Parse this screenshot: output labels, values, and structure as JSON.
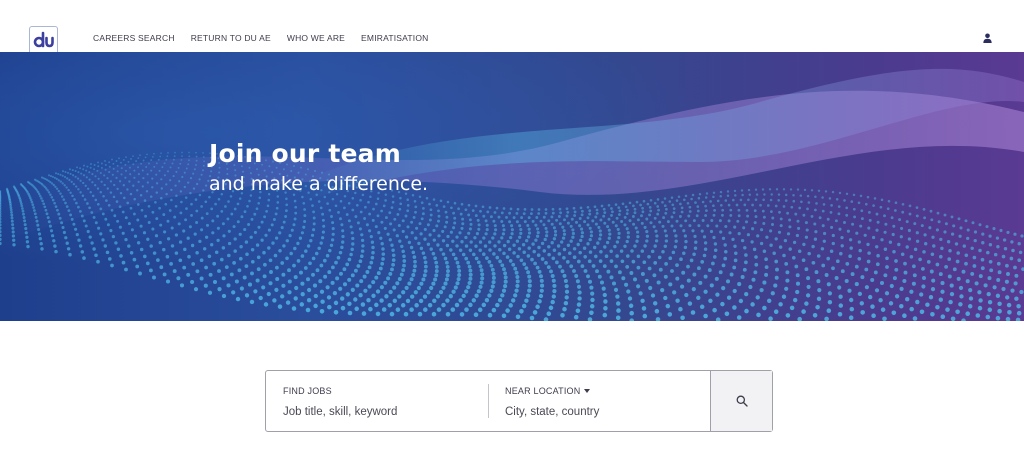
{
  "header": {
    "logo_text": "du",
    "nav": [
      {
        "label": "CAREERS SEARCH"
      },
      {
        "label": "RETURN TO DU AE"
      },
      {
        "label": "WHO WE ARE"
      },
      {
        "label": "EMIRATISATION"
      }
    ],
    "user_icon": "user-icon"
  },
  "hero": {
    "title": "Join our team",
    "subtitle": "and make a difference."
  },
  "search": {
    "jobs_label": "FIND JOBS",
    "jobs_placeholder": "Job title, skill, keyword",
    "location_label": "NEAR LOCATION",
    "location_placeholder": "City, state, country",
    "submit_icon": "search-icon"
  },
  "colors": {
    "brand": "#3b3f9e",
    "hero_dark": "#1e3f8c",
    "hero_purple": "#5a3a92",
    "dots": "#4fb6e6"
  }
}
